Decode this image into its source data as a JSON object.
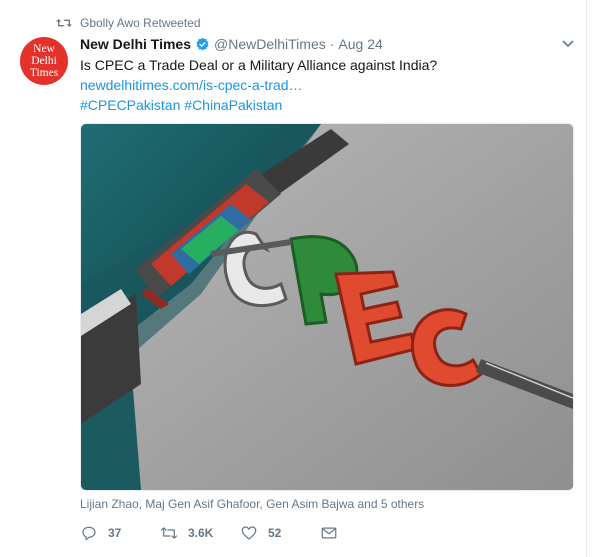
{
  "retweet_notice": {
    "text": "Gbolly Awo Retweeted"
  },
  "author": {
    "avatar_lines": [
      "New",
      "Delhi",
      "Times"
    ],
    "name": "New Delhi Times",
    "handle": "@NewDelhiTimes",
    "separator": "·",
    "date": "Aug 24"
  },
  "tweet": {
    "text": "Is CPEC a Trade Deal or a Military Alliance against India?",
    "link": "newdelhitimes.com/is-cpec-a-trad…",
    "hashtags": [
      "#CPECPakistan",
      "#ChinaPakistan"
    ]
  },
  "media": {
    "tagged_text": "Lijian Zhao, Maj Gen Asif Ghafoor, Gen Asim Bajwa and 5 others"
  },
  "actions": {
    "replies": "37",
    "retweets": "3.6K",
    "likes": "52"
  },
  "colors": {
    "accent": "#1b95e0",
    "muted": "#657786",
    "avatar_red": "#e4322b",
    "verified": "#1da1f2"
  },
  "icons": [
    "retweet-icon",
    "verified-badge-icon",
    "chevron-down-icon",
    "reply-icon",
    "retweet-icon",
    "heart-icon",
    "message-icon"
  ]
}
